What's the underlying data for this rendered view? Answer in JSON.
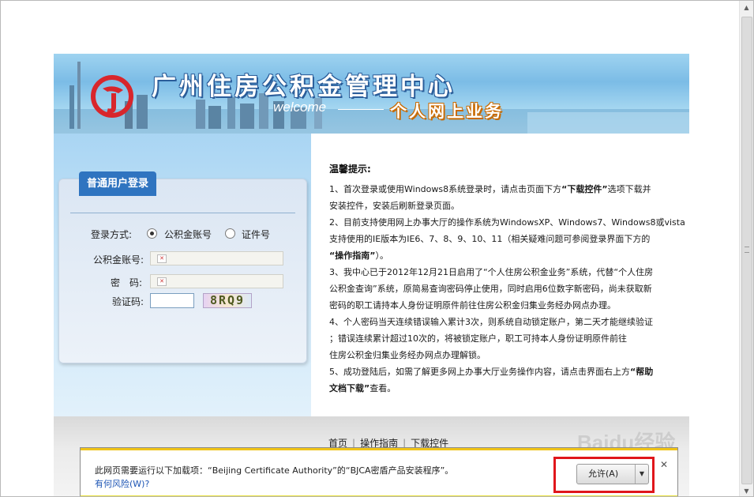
{
  "banner": {
    "title": "广州住房公积金管理中心",
    "welcome": "welcome",
    "subtitle": "个人网上业务"
  },
  "login": {
    "tab_label": "普通用户登录",
    "method_label": "登录方式:",
    "option_account": "公积金账号",
    "option_id": "证件号",
    "selected_option": "公积金账号",
    "account_label": "公积金账号:",
    "password_label": "密　码:",
    "captcha_label": "验证码:",
    "captcha_value": "8RQ9"
  },
  "notice": {
    "title": "温馨提示:",
    "items": [
      [
        "1、首次登录或使用Windows8系统登录时，请点击页面下方",
        "“下载控件”",
        "选项下载并"
      ],
      [
        "安装控件，安装后刷新登录页面。"
      ],
      [
        "2、目前支持使用网上办事大厅的操作系统为WindowsXP、Windows7、Windows8或vista"
      ],
      [
        "支持使用的IE版本为IE6、7、8、9、10、11（相关疑难问题可参阅登录界面下方的"
      ],
      [
        "",
        "“操作指南”",
        "）。"
      ],
      [
        "3、我中心已于2012年12月21日启用了“个人住房公积金业务”系统，代替“个人住房"
      ],
      [
        "公积金查询”系统，原简易查询密码停止使用，同时启用6位数字新密码，尚未获取新"
      ],
      [
        "密码的职工请持本人身份证明原件前往住房公积金归集业务经办网点办理。"
      ],
      [
        "4、个人密码当天连续错误输入累计3次，则系统自动锁定账户，第二天才能继续验证"
      ],
      [
        "；错误连续累计超过10次的，将被锁定账户，职工可持本人身份证明原件前往"
      ],
      [
        "住房公积金归集业务经办网点办理解锁。"
      ],
      [
        "5、成功登陆后，如需了解更多网上办事大厅业务操作内容，请点击界面右上方",
        "“帮助",
        ""
      ],
      [
        "",
        "文档下载”",
        "查看。"
      ]
    ]
  },
  "footer": {
    "links": [
      "首页",
      "操作指南",
      "下载控件"
    ]
  },
  "notification": {
    "message": "此网页需要运行以下加载项：“Beijing Certificate Authority”的“BJCA密盾产品安装程序”。",
    "risk_link": "有何风险(W)?",
    "allow_button": "允许(A)"
  },
  "watermark": {
    "text": "Baidu经验"
  },
  "colors": {
    "tab_blue": "#2f74c0",
    "highlight_red": "#e0161b",
    "notif_link": "#1c54b4"
  }
}
